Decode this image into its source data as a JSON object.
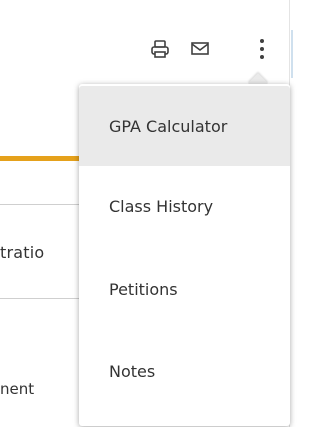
{
  "toolbar": {
    "print_icon": "printer-icon",
    "mail_icon": "mail-icon",
    "more_icon": "more-vertical-icon"
  },
  "background": {
    "tab_label_fragment": "tratio",
    "text_fragment": "nent"
  },
  "menu": {
    "items": [
      {
        "label": "GPA Calculator",
        "active": true
      },
      {
        "label": "Class History",
        "active": false
      },
      {
        "label": "Petitions",
        "active": false
      },
      {
        "label": "Notes",
        "active": false
      }
    ]
  },
  "colors": {
    "accent": "#e5a11b",
    "menu_active_bg": "#eaeaea",
    "text": "#333333"
  }
}
